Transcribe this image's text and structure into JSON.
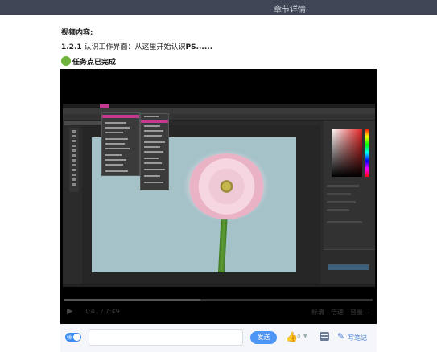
{
  "header": {
    "title": "章节详情"
  },
  "content": {
    "heading": "视频内容:",
    "lesson_number": "1.2.1",
    "lesson_text": "认识工作界面：从这里开始认识",
    "lesson_suffix": "PS......",
    "status_text": "任务点已完成"
  },
  "player": {
    "play_icon": "play-icon",
    "time": "1:41 / 7:49",
    "controls": [
      "标清",
      "倍速",
      "音量",
      "全屏"
    ],
    "progress": 0.44
  },
  "bottom_bar": {
    "toggle_label": "弹",
    "send_label": "发送",
    "like_count": "0",
    "note_label": "写笔记"
  },
  "colors": {
    "header_bg": "#3f4554",
    "accent": "#4e96f5",
    "status_green": "#6fb33d"
  }
}
